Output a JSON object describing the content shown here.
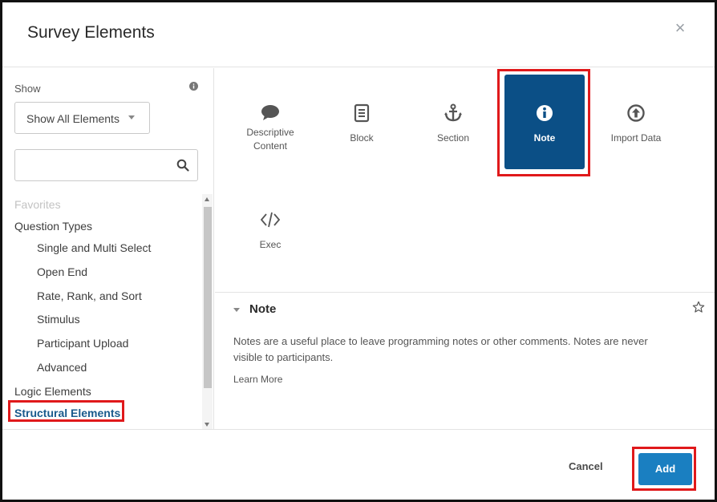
{
  "dialog": {
    "title": "Survey Elements",
    "close_label": "×"
  },
  "sidebar": {
    "show_label": "Show",
    "show_select_value": "Show All Elements",
    "search_placeholder": "",
    "categories": [
      {
        "label": "Favorites",
        "level": "top",
        "state": "disabled"
      },
      {
        "label": "Question Types",
        "level": "top",
        "state": "normal"
      },
      {
        "label": "Single and Multi Select",
        "level": "sub",
        "state": "normal"
      },
      {
        "label": "Open End",
        "level": "sub",
        "state": "normal"
      },
      {
        "label": "Rate, Rank, and Sort",
        "level": "sub",
        "state": "normal"
      },
      {
        "label": "Stimulus",
        "level": "sub",
        "state": "normal"
      },
      {
        "label": "Participant Upload",
        "level": "sub",
        "state": "normal"
      },
      {
        "label": "Advanced",
        "level": "sub",
        "state": "normal"
      },
      {
        "label": "Logic Elements",
        "level": "top",
        "state": "normal"
      },
      {
        "label": "Structural Elements",
        "level": "top",
        "state": "active"
      }
    ]
  },
  "elements": [
    {
      "label": "Descriptive Content",
      "icon": "comment-icon"
    },
    {
      "label": "Block",
      "icon": "document-icon"
    },
    {
      "label": "Section",
      "icon": "anchor-icon"
    },
    {
      "label": "Note",
      "icon": "info-icon",
      "selected": true
    },
    {
      "label": "Import Data",
      "icon": "upload-circle-icon"
    },
    {
      "label": "Exec",
      "icon": "code-icon"
    }
  ],
  "detail": {
    "title": "Note",
    "description": "Notes are a useful place to leave programming notes or other comments. Notes are never visible to participants.",
    "learn_more": "Learn More"
  },
  "footer": {
    "cancel_label": "Cancel",
    "add_label": "Add"
  },
  "colors": {
    "selected_tile": "#0b4f86",
    "add_button": "#1a7fc1",
    "active_category": "#195a8c",
    "highlight": "#e0191b"
  }
}
